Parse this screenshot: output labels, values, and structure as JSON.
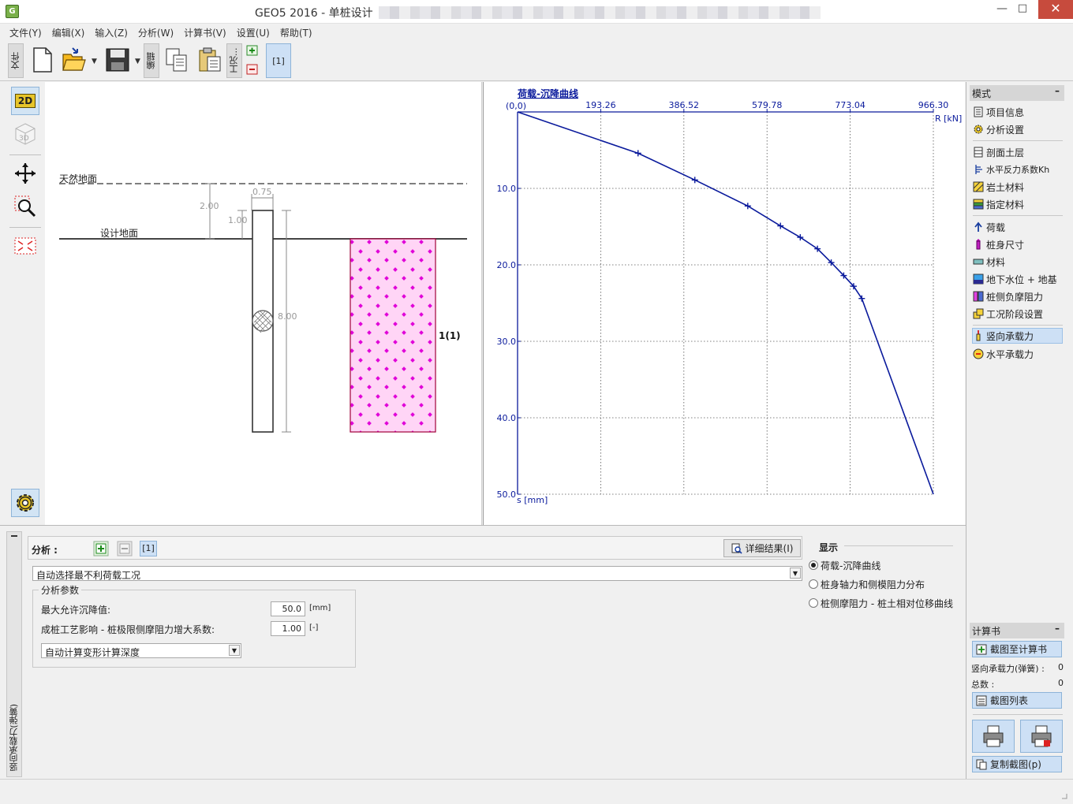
{
  "window": {
    "title": "GEO5 2016 - 单桩设计",
    "minimize": "—",
    "maximize": "□",
    "close": "✕"
  },
  "menu": [
    "文件(Y)",
    "编辑(X)",
    "输入(Z)",
    "分析(W)",
    "计算书(V)",
    "设置(U)",
    "帮助(T)"
  ],
  "toolbar": {
    "file_tab": "文件",
    "edit_tab": "编辑",
    "stage_tab": "工况...",
    "stage_current": "[1]"
  },
  "leftbar": {
    "btn_2d": "2D",
    "btn_3d": "3D"
  },
  "geometry": {
    "natural_ground_label": "天然地面",
    "design_ground_label": "设计地面",
    "dim_diameter": "0.75",
    "dim_top_offset": "2.00",
    "dim_pile_head": "1.00",
    "dim_pile_length": "8.00",
    "soil_layer_label": "1(1)"
  },
  "chart_data": {
    "type": "line",
    "title": "荷载-沉降曲线",
    "xlabel": "R [kN]",
    "ylabel": "s [mm]",
    "origin_label": "(0,0)",
    "x_ticks": [
      "193.26",
      "386.52",
      "579.78",
      "773.04",
      "966.30"
    ],
    "y_ticks": [
      "10.0",
      "20.0",
      "30.0",
      "40.0",
      "50.0"
    ],
    "xlim": [
      0,
      966.3
    ],
    "ylim": [
      0,
      50
    ],
    "y_inverted": true,
    "x_axis_position": "top",
    "grid": true,
    "series": [
      {
        "x": [
          0,
          280,
          412,
          535,
          611,
          657,
          697,
          729,
          758,
          781,
          800,
          966.3
        ],
        "y": [
          0,
          5.4,
          8.9,
          12.3,
          14.9,
          16.4,
          17.9,
          19.7,
          21.4,
          22.8,
          24.4,
          50.0
        ]
      }
    ],
    "marked_points": 10
  },
  "modes": {
    "header": "模式",
    "groups": [
      [
        "项目信息",
        "分析设置"
      ],
      [
        "剖面土层",
        "水平反力系数Kh",
        "岩土材料",
        "指定材料"
      ],
      [
        "荷载",
        "桩身尺寸",
        "材料",
        "地下水位 + 地基",
        "桩侧负摩阻力",
        "工况阶段设置"
      ],
      [
        "竖向承载力",
        "水平承载力"
      ]
    ],
    "active": "竖向承载力"
  },
  "report": {
    "header": "计算书",
    "add_button": "截图至计算书",
    "count_label": "竖向承载力(弹簧) :",
    "count_value": "0",
    "total_label": "总数 :",
    "total_value": "0",
    "list_button": "截图列表",
    "copy_button": "复制截图(p)"
  },
  "analysis": {
    "vertical_tab": "竖向承载力(弹簧)",
    "label": "分析 :",
    "current": "[1]",
    "detail_button": "详细结果(I)",
    "worst_case_select": "自动选择最不利荷载工况",
    "params_group": "分析参数",
    "max_settlement_label": "最大允许沉降值:",
    "max_settlement_value": "50.0",
    "max_settlement_unit": "[mm]",
    "factor_label": "成桩工艺影响 - 桩极限侧摩阻力增大系数:",
    "factor_value": "1.00",
    "factor_unit": "[-]",
    "depth_select": "自动计算变形计算深度"
  },
  "display": {
    "header": "显示",
    "options": [
      "荷载-沉降曲线",
      "桩身轴力和侧模阻力分布",
      "桩侧摩阻力 - 桩土相对位移曲线"
    ],
    "selected": 0
  },
  "colors": {
    "accent": "#0a1a9c",
    "soil": "#ffd5f6",
    "soil_dot": "#e000d8",
    "active_bg": "#cde0f5"
  }
}
